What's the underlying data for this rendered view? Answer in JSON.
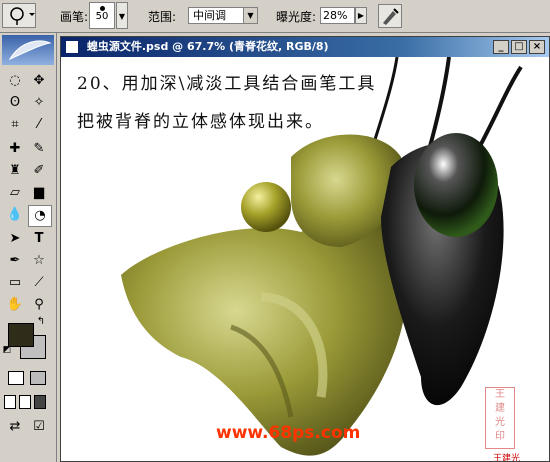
{
  "options_bar": {
    "brush_label": "画笔:",
    "brush_size": "50",
    "range_label": "范围:",
    "range_value": "中间调",
    "exposure_label": "曝光度:",
    "exposure_value": "28%"
  },
  "document": {
    "title": "蝗虫源文件.psd @ 67.7% (青脊花纹, RGB/8)",
    "caption_line1": "20、用加深\\减淡工具结合画笔工具",
    "caption_line2": "把被背脊的立体感体现出来。",
    "watermark": "www.68ps.com"
  },
  "toolbox": {
    "foreground_color": "#2f2c1a",
    "background_color": "#c0c0c0"
  },
  "colors": {
    "titlebar": "#0a246a",
    "watermark": "#ff3300",
    "body_green": "#9a9a38",
    "head_black": "#1a1a1a"
  }
}
